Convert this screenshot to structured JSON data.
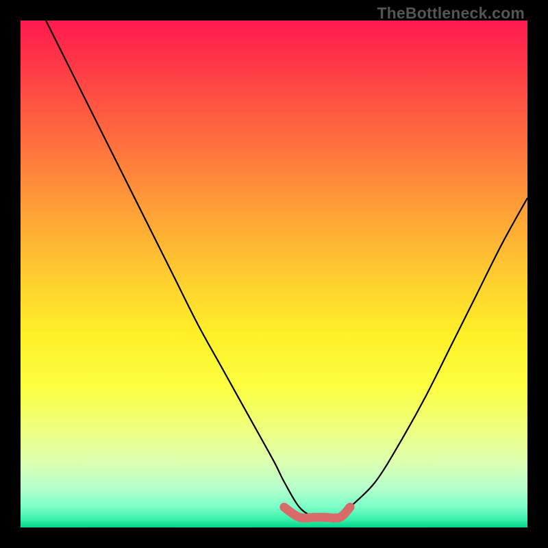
{
  "attribution": "TheBottleneck.com",
  "chart_data": {
    "type": "line",
    "title": "",
    "xlabel": "",
    "ylabel": "",
    "xlim": [
      0,
      100
    ],
    "ylim": [
      0,
      100
    ],
    "series": [
      {
        "name": "bottleneck-curve",
        "x": [
          5,
          10,
          15,
          20,
          25,
          30,
          35,
          40,
          45,
          50,
          52,
          55,
          58,
          60,
          63,
          65,
          70,
          75,
          80,
          85,
          90,
          95,
          100
        ],
        "values": [
          100,
          90,
          80,
          70,
          60,
          50,
          40,
          31,
          22,
          13,
          9,
          4,
          2,
          2,
          2,
          4,
          9,
          17,
          26,
          36,
          46,
          56,
          65
        ]
      },
      {
        "name": "plateau-marker",
        "x": [
          52,
          55,
          58,
          60,
          63,
          65
        ],
        "values": [
          4,
          2,
          2,
          2,
          2,
          4
        ]
      }
    ],
    "gradient_stops": [
      {
        "pct": 0,
        "color": "#ff1a4f"
      },
      {
        "pct": 12,
        "color": "#ff4444"
      },
      {
        "pct": 27,
        "color": "#ff7a3c"
      },
      {
        "pct": 40,
        "color": "#ffa936"
      },
      {
        "pct": 52,
        "color": "#ffd22e"
      },
      {
        "pct": 62,
        "color": "#fff028"
      },
      {
        "pct": 72,
        "color": "#fbff40"
      },
      {
        "pct": 80,
        "color": "#f0ff7a"
      },
      {
        "pct": 87,
        "color": "#dcffb0"
      },
      {
        "pct": 92,
        "color": "#b8ffcc"
      },
      {
        "pct": 96,
        "color": "#7affc8"
      },
      {
        "pct": 98.5,
        "color": "#36f0a8"
      },
      {
        "pct": 100,
        "color": "#00d488"
      }
    ]
  }
}
